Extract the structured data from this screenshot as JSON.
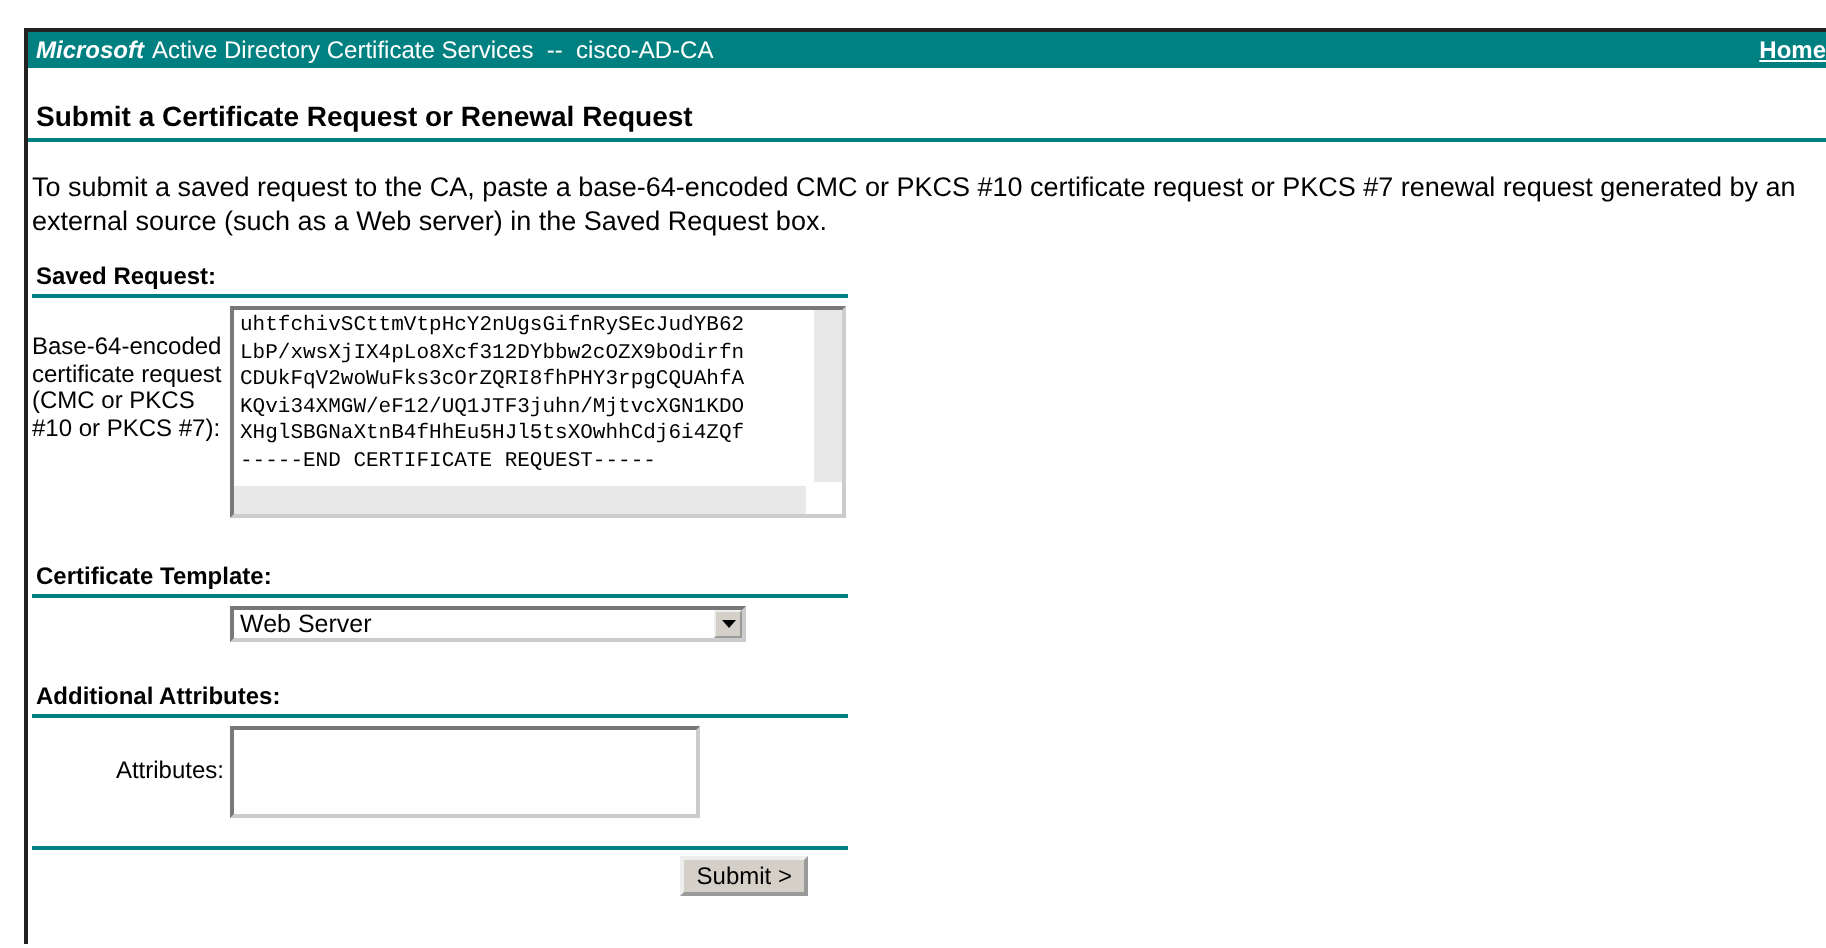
{
  "header": {
    "brand": "Microsoft",
    "title": "Active Directory Certificate Services  --  cisco-AD-CA",
    "home_link": "Home"
  },
  "page_title": "Submit a Certificate Request or Renewal Request",
  "intro": "To submit a saved request to the CA, paste a base-64-encoded CMC or PKCS #10 certificate request or PKCS #7 renewal request generated by an external source (such as a Web server) in the Saved Request box.",
  "saved_request": {
    "heading": "Saved Request:",
    "label": "Base-64-encoded certificate request (CMC or PKCS #10 or PKCS #7):",
    "lines": [
      "uhtfchivSCttmVtpHcY2nUgsGifnRySEcJudYB62",
      "LbP/xwsXjIX4pLo8Xcf312DYbbw2cOZX9bOdirfn",
      "CDUkFqV2woWuFks3cOrZQRI8fhPHY3rpgCQUAhfA",
      "KQvi34XMGW/eF12/UQ1JTF3juhn/MjtvcXGN1KDO",
      "XHglSBGNaXtnB4fHhEu5HJl5tsXOwhhCdj6i4ZQf",
      "-----END CERTIFICATE REQUEST-----"
    ]
  },
  "certificate_template": {
    "heading": "Certificate Template:",
    "value": "Web Server"
  },
  "additional_attributes": {
    "heading": "Additional Attributes:",
    "label": "Attributes:"
  },
  "submit_button": "Submit >"
}
